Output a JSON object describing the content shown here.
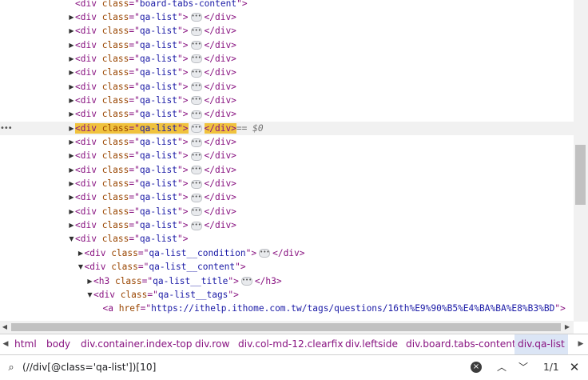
{
  "tree": {
    "selected_suffix": "== $0",
    "lines": [
      {
        "indent": 0,
        "toggle": "",
        "kind": "cut",
        "tag": "div",
        "attr": "class",
        "value": "board-tabs-content"
      },
      {
        "indent": 0,
        "toggle": "collapsed",
        "kind": "collapsed",
        "tag": "div",
        "attr": "class",
        "value": "qa-list"
      },
      {
        "indent": 0,
        "toggle": "collapsed",
        "kind": "collapsed",
        "tag": "div",
        "attr": "class",
        "value": "qa-list"
      },
      {
        "indent": 0,
        "toggle": "collapsed",
        "kind": "collapsed",
        "tag": "div",
        "attr": "class",
        "value": "qa-list"
      },
      {
        "indent": 0,
        "toggle": "collapsed",
        "kind": "collapsed",
        "tag": "div",
        "attr": "class",
        "value": "qa-list"
      },
      {
        "indent": 0,
        "toggle": "collapsed",
        "kind": "collapsed",
        "tag": "div",
        "attr": "class",
        "value": "qa-list"
      },
      {
        "indent": 0,
        "toggle": "collapsed",
        "kind": "collapsed",
        "tag": "div",
        "attr": "class",
        "value": "qa-list"
      },
      {
        "indent": 0,
        "toggle": "collapsed",
        "kind": "collapsed",
        "tag": "div",
        "attr": "class",
        "value": "qa-list"
      },
      {
        "indent": 0,
        "toggle": "collapsed",
        "kind": "collapsed",
        "tag": "div",
        "attr": "class",
        "value": "qa-list"
      },
      {
        "indent": 0,
        "toggle": "collapsed",
        "kind": "collapsed",
        "tag": "div",
        "attr": "class",
        "value": "qa-list",
        "selected": true
      },
      {
        "indent": 0,
        "toggle": "collapsed",
        "kind": "collapsed",
        "tag": "div",
        "attr": "class",
        "value": "qa-list"
      },
      {
        "indent": 0,
        "toggle": "collapsed",
        "kind": "collapsed",
        "tag": "div",
        "attr": "class",
        "value": "qa-list"
      },
      {
        "indent": 0,
        "toggle": "collapsed",
        "kind": "collapsed",
        "tag": "div",
        "attr": "class",
        "value": "qa-list"
      },
      {
        "indent": 0,
        "toggle": "collapsed",
        "kind": "collapsed",
        "tag": "div",
        "attr": "class",
        "value": "qa-list"
      },
      {
        "indent": 0,
        "toggle": "collapsed",
        "kind": "collapsed",
        "tag": "div",
        "attr": "class",
        "value": "qa-list"
      },
      {
        "indent": 0,
        "toggle": "collapsed",
        "kind": "collapsed",
        "tag": "div",
        "attr": "class",
        "value": "qa-list"
      },
      {
        "indent": 0,
        "toggle": "collapsed",
        "kind": "collapsed",
        "tag": "div",
        "attr": "class",
        "value": "qa-list"
      },
      {
        "indent": 0,
        "toggle": "expanded",
        "kind": "open",
        "tag": "div",
        "attr": "class",
        "value": "qa-list"
      },
      {
        "indent": 1,
        "toggle": "collapsed",
        "kind": "collapsed",
        "tag": "div",
        "attr": "class",
        "value": "qa-list__condition"
      },
      {
        "indent": 1,
        "toggle": "expanded",
        "kind": "open",
        "tag": "div",
        "attr": "class",
        "value": "qa-list__content"
      },
      {
        "indent": 2,
        "toggle": "collapsed",
        "kind": "collapsed",
        "tag": "h3",
        "attr": "class",
        "value": "qa-list__title"
      },
      {
        "indent": 2,
        "toggle": "expanded",
        "kind": "open",
        "tag": "div",
        "attr": "class",
        "value": "qa-list__tags"
      },
      {
        "indent": 3,
        "toggle": "",
        "kind": "open-noclose",
        "tag": "a",
        "attr": "href",
        "value": "https://ithelp.ithome.com.tw/tags/questions/16th%E9%90%B5%E4%BA%BA%E8%B3%BD"
      }
    ]
  },
  "breadcrumbs": [
    "html",
    "body",
    "div.container.index-top",
    "div.row",
    "div.col-md-12.clearfix",
    "div.leftside",
    "div.board.tabs-content",
    "div.qa-list"
  ],
  "breadcrumb_active": "div.qa-list",
  "search": {
    "query": "(//div[@class='qa-list'])[10]",
    "count": "1/1"
  },
  "colors": {
    "tag": "#881280",
    "attr": "#994500",
    "value": "#1a1aa6",
    "highlight": "#f0c23d",
    "selected_row": "#f1f1f1"
  }
}
